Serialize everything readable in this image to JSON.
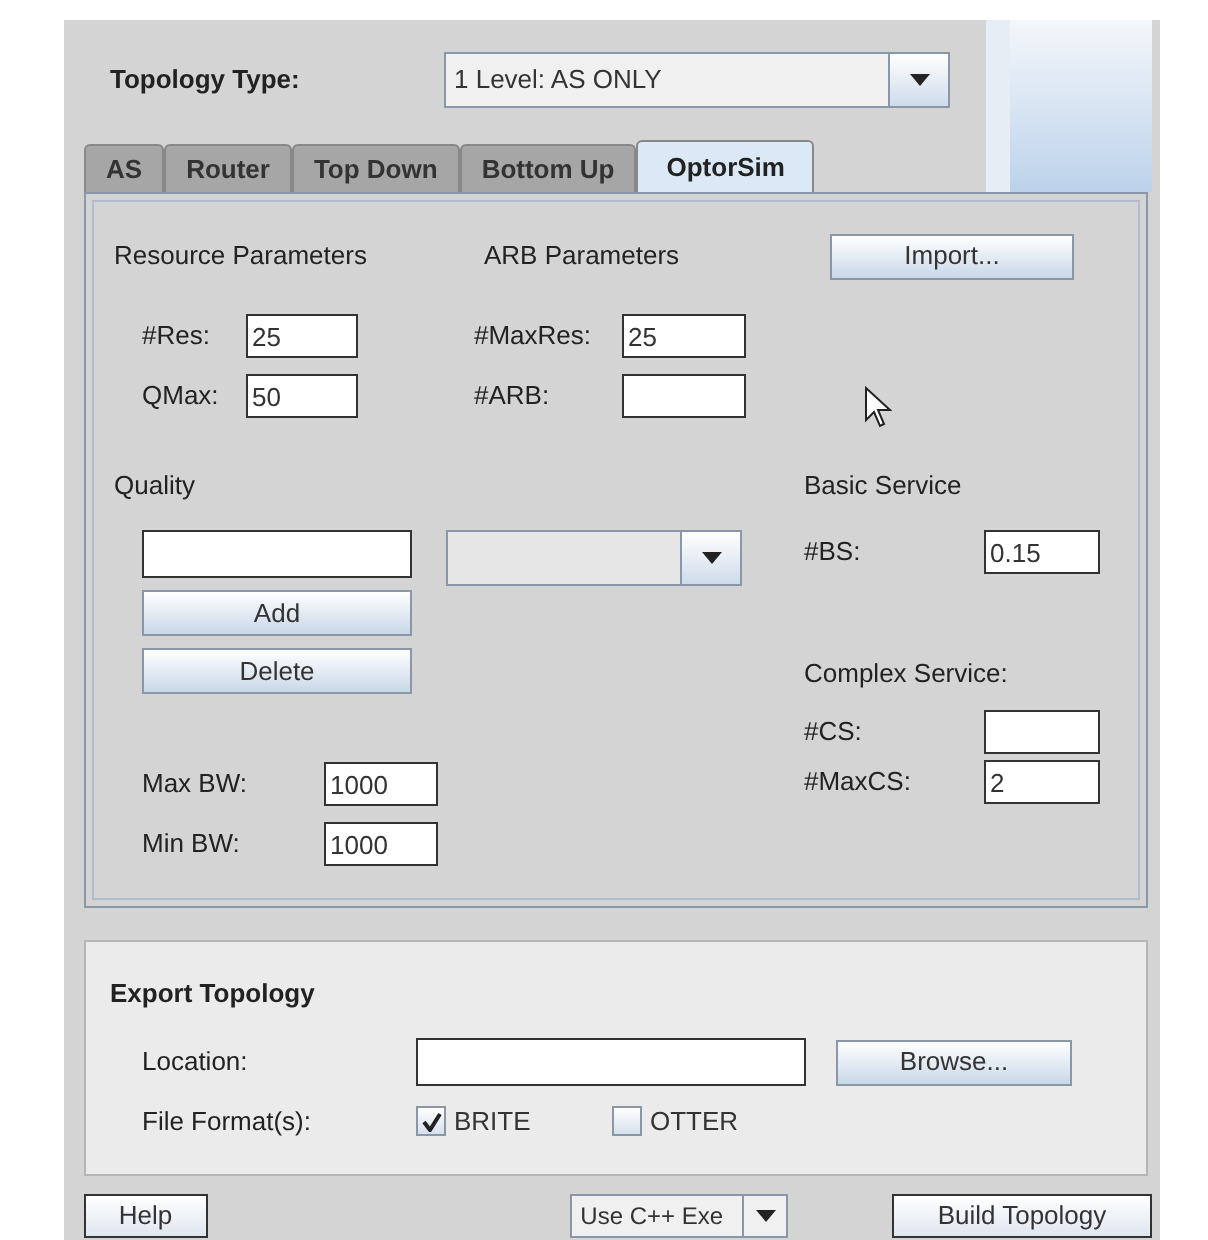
{
  "topology_type": {
    "label": "Topology Type:",
    "value": "1 Level: AS ONLY"
  },
  "tabs": [
    {
      "label": "AS",
      "selected": false
    },
    {
      "label": "Router",
      "selected": false
    },
    {
      "label": "Top Down",
      "selected": false
    },
    {
      "label": "Bottom Up",
      "selected": false
    },
    {
      "label": "OptorSim",
      "selected": true
    }
  ],
  "resource_parameters": {
    "title": "Resource Parameters",
    "fields": [
      {
        "label": "#Res:",
        "value": "25"
      },
      {
        "label": "QMax:",
        "value": "50"
      }
    ]
  },
  "arb_parameters": {
    "title": "ARB Parameters",
    "fields": [
      {
        "label": "#MaxRes:",
        "value": "25"
      },
      {
        "label": "#ARB:"
      }
    ]
  },
  "import_button": "Import...",
  "quality": {
    "title": "Quality",
    "buttons": [
      "Add",
      "Delete"
    ]
  },
  "bandwidth": [
    {
      "label": "Max BW:",
      "value": "1000"
    },
    {
      "label": "Min BW:",
      "value": "1000"
    }
  ],
  "basic_service": {
    "title": "Basic Service",
    "fields": [
      {
        "label": "#BS:",
        "value": "0.15"
      }
    ]
  },
  "complex_service": {
    "title": "Complex Service:",
    "fields": [
      {
        "label": "#CS:"
      },
      {
        "label": "#MaxCS:",
        "value": "2"
      }
    ]
  },
  "export_topology": {
    "title": "Export Topology",
    "location_label": "Location:",
    "browse_button": "Browse...",
    "format_label": "File Format(s):",
    "formats": [
      {
        "label": "BRITE",
        "checked": true
      },
      {
        "label": "OTTER",
        "checked": false
      }
    ]
  },
  "bottom_bar": {
    "help_button": "Help",
    "exe_combo": "Use C++ Exe",
    "build_button": "Build Topology"
  }
}
